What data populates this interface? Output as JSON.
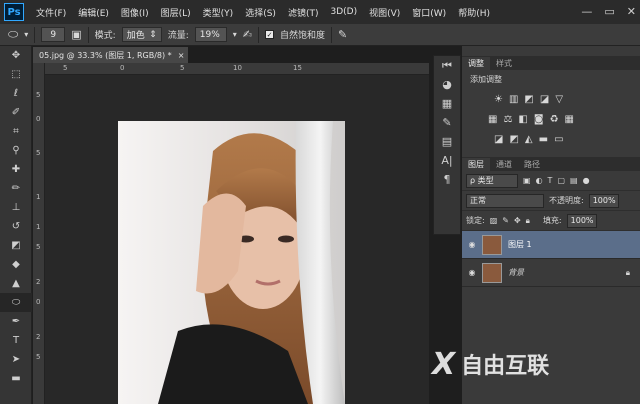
{
  "app": {
    "logo": "Ps"
  },
  "menu": [
    "文件(F)",
    "编辑(E)",
    "图像(I)",
    "图层(L)",
    "类型(Y)",
    "选择(S)",
    "滤镜(T)",
    "3D(D)",
    "视图(V)",
    "窗口(W)",
    "帮助(H)"
  ],
  "window_controls": {
    "minimize": "—",
    "restore": "▭",
    "close": "✕"
  },
  "options": {
    "brush_size": "9",
    "mode_label": "模式:",
    "mode_value": "加色",
    "flow_label": "流量:",
    "flow_value": "19%",
    "natural_saturation": "自然饱和度"
  },
  "document": {
    "tab_title": "05.jpg @ 33.3% (图层 1, RGB/8) *",
    "close": "×"
  },
  "ruler": {
    "top": [
      "5",
      "0",
      "5",
      "10",
      "15"
    ],
    "left": [
      "5",
      "0",
      "5",
      "1",
      "1",
      "5",
      "2",
      "0",
      "2",
      "5"
    ]
  },
  "adjustments": {
    "tabs": [
      "调整",
      "样式"
    ],
    "title": "添加调整"
  },
  "layers": {
    "tabs": [
      "图层",
      "通道",
      "路径"
    ],
    "filter_label": "ρ 类型",
    "blend_mode": "正常",
    "opacity_label": "不透明度:",
    "opacity_value": "100%",
    "lock_label": "锁定:",
    "fill_label": "填充:",
    "fill_value": "100%",
    "items": [
      {
        "name": "图层 1",
        "selected": true
      },
      {
        "name": "背景",
        "locked": true
      }
    ]
  },
  "watermark": {
    "text": "自由互联"
  },
  "colors": {
    "accent": "#31a8ff",
    "selected_layer": "#5b6e8a",
    "panel_bg": "#3a3a3a"
  }
}
